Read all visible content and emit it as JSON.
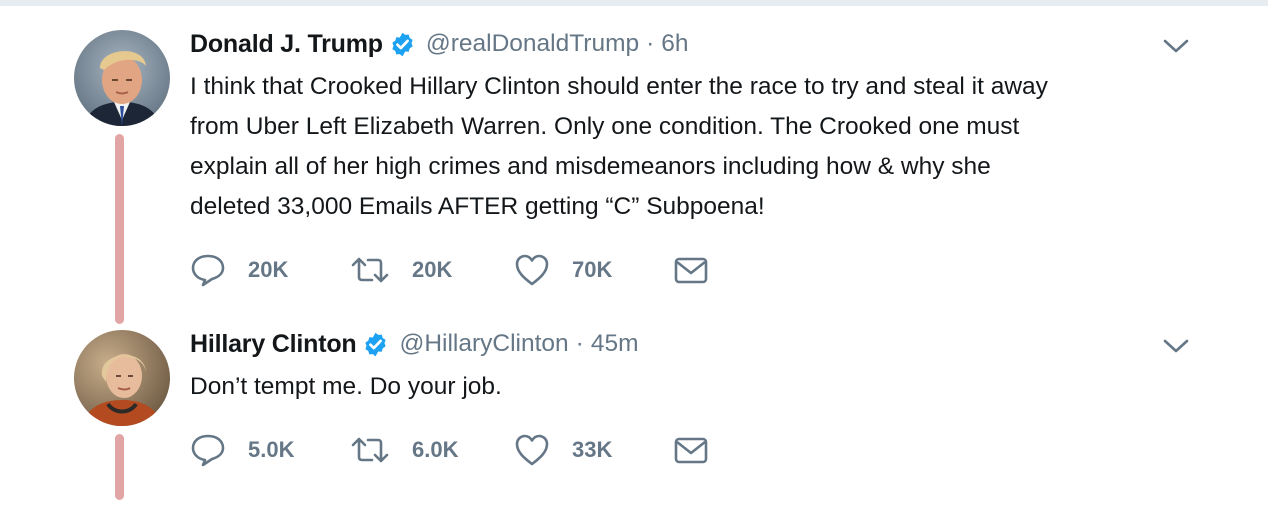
{
  "theme": {
    "thread_line_color": "#e2a5a5",
    "verified_color": "#1da1f2",
    "secondary_text_color": "#657786"
  },
  "tweets": [
    {
      "name": "Donald J. Trump",
      "handle": "@realDonaldTrump",
      "separator": "·",
      "time": "6h",
      "text": "I think that Crooked Hillary Clinton should enter the race to try and steal it away\nfrom Uber Left Elizabeth Warren. Only one condition. The Crooked one must\nexplain all of her high crimes and misdemeanors including how & why she\ndeleted 33,000 Emails AFTER getting “C” Subpoena!",
      "replies": "20K",
      "retweets": "20K",
      "likes": "70K",
      "icons": [
        "verified-badge-icon",
        "chevron-down-icon",
        "reply-icon",
        "retweet-icon",
        "like-icon",
        "direct-message-icon"
      ]
    },
    {
      "name": "Hillary Clinton",
      "handle": "@HillaryClinton",
      "separator": "·",
      "time": "45m",
      "text": "Don’t tempt me. Do your job.",
      "replies": "5.0K",
      "retweets": "6.0K",
      "likes": "33K",
      "icons": [
        "verified-badge-icon",
        "chevron-down-icon",
        "reply-icon",
        "retweet-icon",
        "like-icon",
        "direct-message-icon"
      ]
    }
  ]
}
